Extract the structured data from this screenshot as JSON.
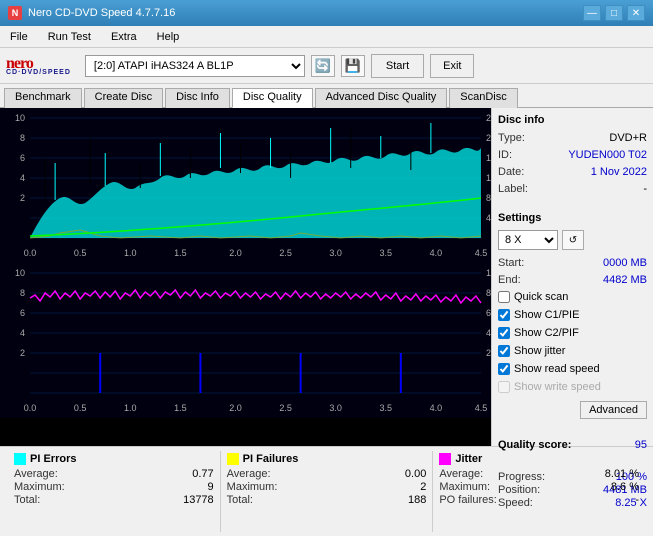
{
  "titleBar": {
    "title": "Nero CD-DVD Speed 4.7.7.16",
    "minBtn": "—",
    "maxBtn": "□",
    "closeBtn": "✕"
  },
  "menuBar": {
    "items": [
      "File",
      "Run Test",
      "Extra",
      "Help"
    ]
  },
  "toolbar": {
    "driveLabel": "[2:0]  ATAPI iHAS324  A BL1P",
    "startBtn": "Start",
    "exitBtn": "Exit"
  },
  "tabs": {
    "items": [
      "Benchmark",
      "Create Disc",
      "Disc Info",
      "Disc Quality",
      "Advanced Disc Quality",
      "ScanDisc"
    ],
    "active": 3
  },
  "discInfo": {
    "sectionTitle": "Disc info",
    "type": {
      "label": "Type:",
      "value": "DVD+R"
    },
    "id": {
      "label": "ID:",
      "value": "YUDEN000 T02"
    },
    "date": {
      "label": "Date:",
      "value": "1 Nov 2022"
    },
    "label": {
      "label": "Label:",
      "value": "-"
    }
  },
  "settings": {
    "sectionTitle": "Settings",
    "speed": "8 X",
    "startLabel": "Start:",
    "startValue": "0000 MB",
    "endLabel": "End:",
    "endValue": "4482 MB",
    "checkboxes": {
      "quickScan": {
        "label": "Quick scan",
        "checked": false
      },
      "showC1PIE": {
        "label": "Show C1/PIE",
        "checked": true
      },
      "showC2PIF": {
        "label": "Show C2/PIF",
        "checked": true
      },
      "showJitter": {
        "label": "Show jitter",
        "checked": true
      },
      "showReadSpeed": {
        "label": "Show read speed",
        "checked": true
      },
      "showWriteSpeed": {
        "label": "Show write speed",
        "checked": false
      }
    },
    "advancedBtn": "Advanced"
  },
  "qualityScore": {
    "label": "Quality score:",
    "value": "95"
  },
  "progress": {
    "progressLabel": "Progress:",
    "progressValue": "100 %",
    "positionLabel": "Position:",
    "positionValue": "4481 MB",
    "speedLabel": "Speed:",
    "speedValue": "8.25 X"
  },
  "stats": {
    "piErrors": {
      "label": "PI Errors",
      "color": "#00ffff",
      "average": {
        "label": "Average:",
        "value": "0.77"
      },
      "maximum": {
        "label": "Maximum:",
        "value": "9"
      },
      "total": {
        "label": "Total:",
        "value": "13778"
      }
    },
    "piFailures": {
      "label": "PI Failures",
      "color": "#ffff00",
      "average": {
        "label": "Average:",
        "value": "0.00"
      },
      "maximum": {
        "label": "Maximum:",
        "value": "2"
      },
      "total": {
        "label": "Total:",
        "value": "188"
      }
    },
    "jitter": {
      "label": "Jitter",
      "color": "#ff00ff",
      "average": {
        "label": "Average:",
        "value": "8.01 %"
      },
      "maximum": {
        "label": "Maximum:",
        "value": "8.6 %"
      },
      "poFailures": {
        "label": "PO failures:",
        "value": "-"
      }
    }
  }
}
